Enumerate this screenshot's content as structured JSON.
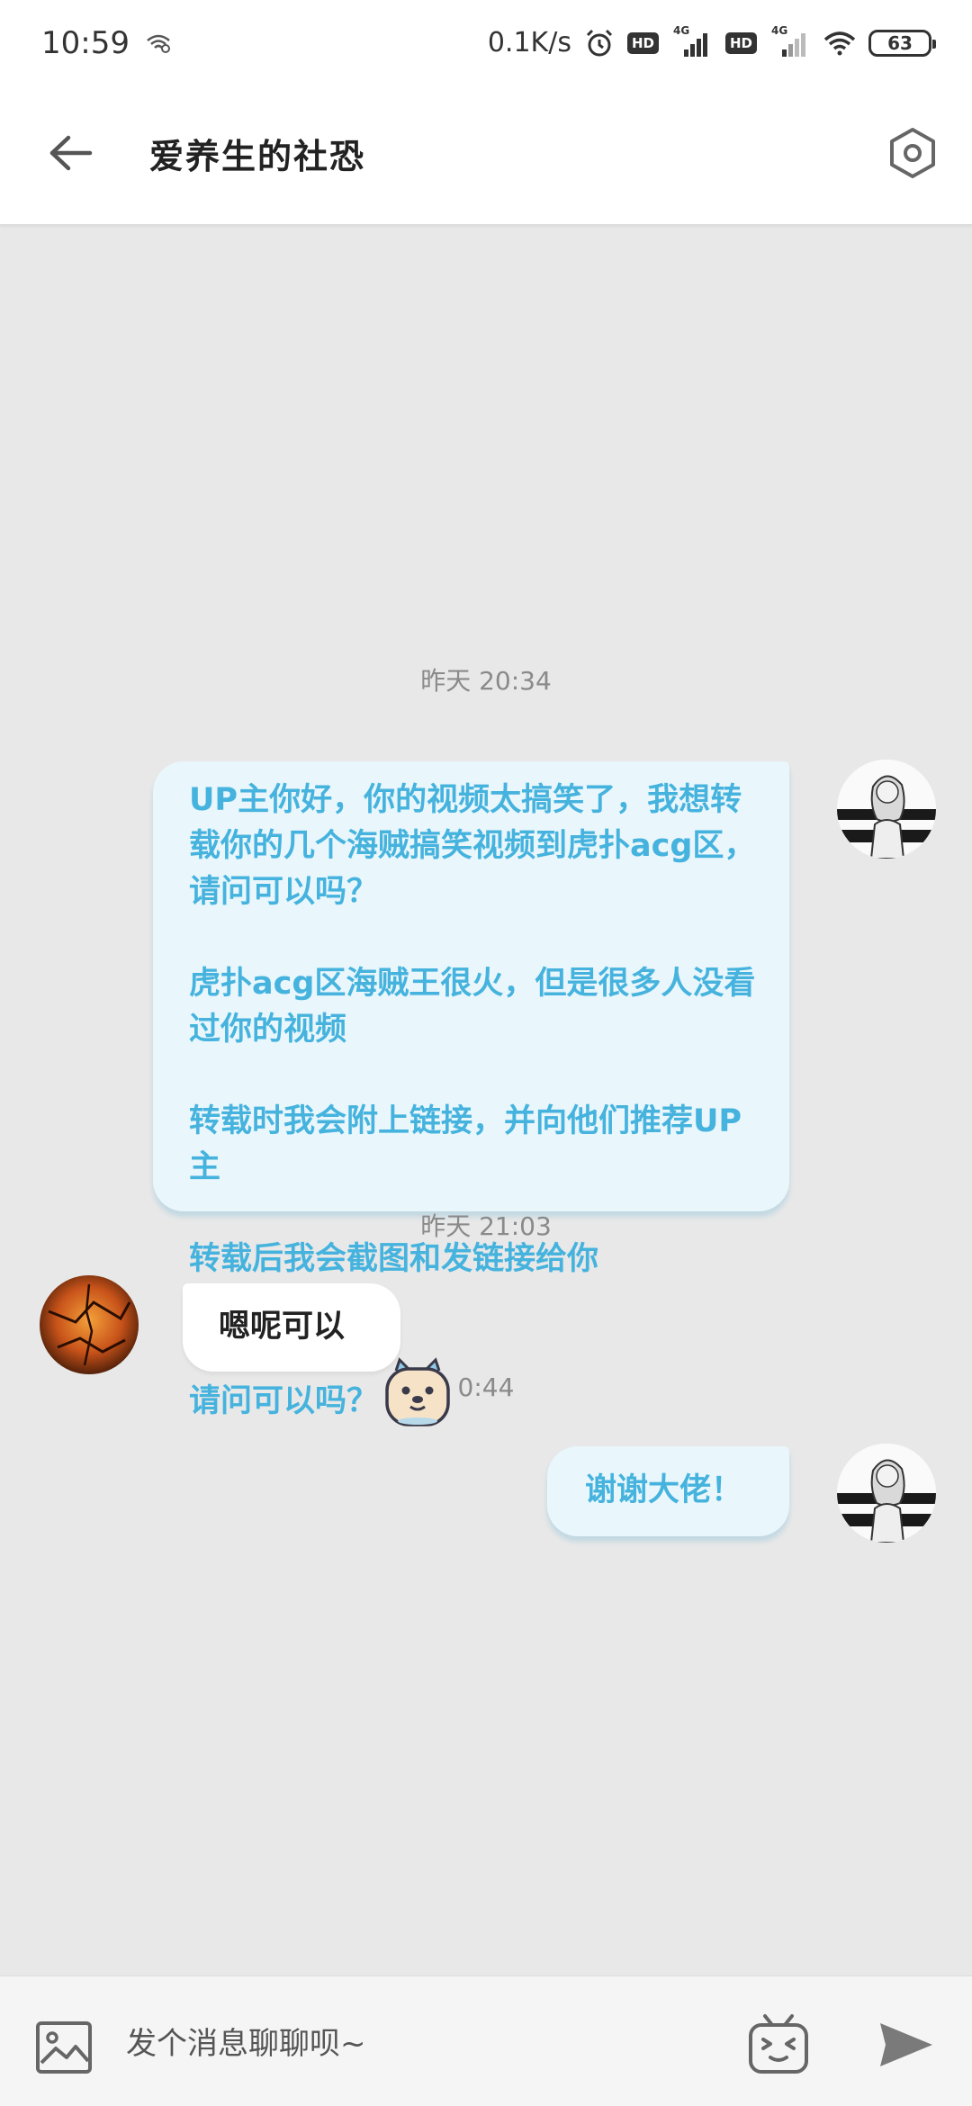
{
  "status_bar": {
    "time": "10:59",
    "net_speed": "0.1K/s",
    "hd_badges": [
      "HD",
      "HD"
    ],
    "signal_labels": [
      "4G",
      "4G"
    ],
    "battery": "63"
  },
  "header": {
    "title": "爱养生的社恐"
  },
  "messages": [
    {
      "type": "timestamp",
      "text": "昨天 20:34"
    },
    {
      "type": "outgoing",
      "paragraphs": [
        "UP主你好，你的视频太搞笑了，我想转载你的几个海贼搞笑视频到虎扑acg区，请问可以吗？",
        "虎扑acg区海贼王很火，但是很多人没看过你的视频",
        "转载时我会附上链接，并向他们推荐UP主",
        "转载后我会截图和发链接给你",
        "请问可以吗？"
      ],
      "emoji": "bear-emoji"
    },
    {
      "type": "timestamp",
      "text": "昨天 21:03"
    },
    {
      "type": "incoming",
      "text": "嗯呢可以"
    },
    {
      "type": "timestamp",
      "text": "0:44"
    },
    {
      "type": "outgoing",
      "text": "谢谢大佬！"
    }
  ],
  "input": {
    "placeholder": "发个消息聊聊呗~"
  },
  "colors": {
    "outgoing_bubble_bg": "#e9f6fc",
    "outgoing_text": "#45b3dd",
    "incoming_bubble_bg": "#ffffff",
    "chat_background": "#e8e8e8"
  }
}
